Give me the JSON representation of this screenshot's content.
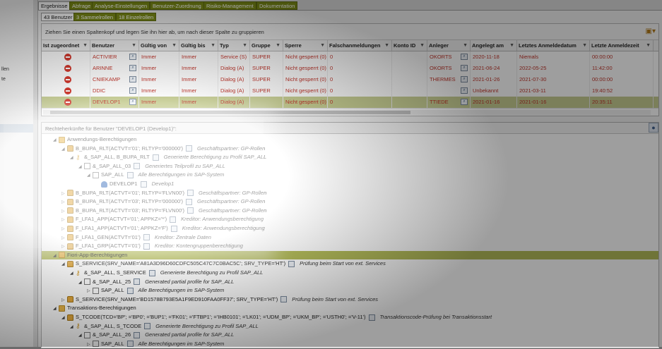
{
  "left_sidebar": {
    "labels": [
      "llen",
      "te"
    ]
  },
  "tabs": [
    {
      "label": "Ergebnisse",
      "active": true
    },
    {
      "label": "Abfrage",
      "active": false
    },
    {
      "label": "Analyse-Einstellungen",
      "active": false
    },
    {
      "label": "Benutzer-Zuordnung",
      "active": false
    },
    {
      "label": "Risiko-Management",
      "active": false
    },
    {
      "label": "Dokumentation",
      "active": false
    }
  ],
  "subtabs": [
    {
      "label": "43 Benutzer",
      "active": true
    },
    {
      "label": "3 Sammelrollen",
      "active": false
    },
    {
      "label": "18 Einzelrollen",
      "active": false
    }
  ],
  "grid": {
    "group_hint": "Ziehen Sie einen Spaltenkopf und legen Sie ihn hier ab, um nach dieser Spalte zu gruppieren",
    "columns": [
      "Ist zugeordnet",
      "Benutzer",
      "Gültig von",
      "Gültig bis",
      "Typ",
      "Gruppe",
      "Sperre",
      "Falschanmeldungen",
      "Konto ID",
      "Anleger",
      "Angelegt am",
      "Letztes Anmeldedatum",
      "Letzte Anmeldezeit"
    ],
    "rows": [
      {
        "user": "ACTIVIER",
        "from": "Immer",
        "to": "Immer",
        "type": "Service (S)",
        "group": "SUPER",
        "lock": "Nicht gesperrt (0)",
        "fails": "0",
        "account": "",
        "creator": "OKORTS",
        "created": "2020-11-18",
        "last_date": "Niemals",
        "last_time": "00:00:00"
      },
      {
        "user": "ARINNE",
        "from": "Immer",
        "to": "Immer",
        "type": "Dialog (A)",
        "group": "SUPER",
        "lock": "Nicht gesperrt (0)",
        "fails": "0",
        "account": "",
        "creator": "OKORTS",
        "created": "2021-06-24",
        "last_date": "2022-05-25",
        "last_time": "11:42:00"
      },
      {
        "user": "CNIEKAMP",
        "from": "Immer",
        "to": "Immer",
        "type": "Dialog (A)",
        "group": "SUPER",
        "lock": "Nicht gesperrt (0)",
        "fails": "0",
        "account": "",
        "creator": "THERMES",
        "created": "2021-01-26",
        "last_date": "2021-07-30",
        "last_time": "00:00:00"
      },
      {
        "user": "DDIC",
        "from": "Immer",
        "to": "Immer",
        "type": "Dialog (A)",
        "group": "SUPER",
        "lock": "Nicht gesperrt (0)",
        "fails": "0",
        "account": "",
        "creator": "",
        "created": "Unbekannt",
        "last_date": "2021-03-11",
        "last_time": "19:40:52"
      },
      {
        "user": "DEVELOP1",
        "from": "Immer",
        "to": "Immer",
        "type": "Dialog (A)",
        "group": "",
        "lock": "Nicht gesperrt (0)",
        "fails": "0",
        "account": "",
        "creator": "TTIEDE",
        "created": "2021-01-16",
        "last_date": "2021-01-16",
        "last_time": "20:35:11"
      }
    ]
  },
  "details": {
    "title": "Rechteherkünfte für Benutzer \"DEVELOP1 (Develop1)\":",
    "tree": [
      {
        "label": "Anwendungs-Berechtigungen",
        "desc": "",
        "icon": "folder-icon",
        "toggle": "◢"
      },
      {
        "label": "B_BUPA_RLT(ACTVT='01'; RLTYP='000000')",
        "desc": "Geschäftspartner: GP-Rollen",
        "icon": "lock-icon",
        "toggle": "◢"
      },
      {
        "label": "&_SAP_ALL, B_BUPA_RLT",
        "desc": "Generierte Berechtigung zu Profil SAP_ALL",
        "icon": "key-icon",
        "toggle": "◢"
      },
      {
        "label": "&_SAP_ALL_03",
        "desc": "Generiertes Teilprofil zu SAP_ALL",
        "icon": "profile-icon",
        "toggle": "◢"
      },
      {
        "label": "SAP_ALL",
        "desc": "Alle Berechtigungen im SAP-System",
        "icon": "profile-icon",
        "toggle": "◢"
      },
      {
        "label": "DEVELOP1",
        "desc": "Develop1",
        "icon": "user-icon",
        "toggle": ""
      },
      {
        "label": "B_BUPA_RLT(ACTVT='01'; RLTYP='FLVN00')",
        "desc": "Geschäftspartner: GP-Rollen",
        "icon": "lock-icon",
        "toggle": "▷"
      },
      {
        "label": "B_BUPA_RLT(ACTVT='03'; RLTYP='000000')",
        "desc": "Geschäftspartner: GP-Rollen",
        "icon": "lock-icon",
        "toggle": "▷"
      },
      {
        "label": "B_BUPA_RLT(ACTVT='03'; RLTYP='FLVN00')",
        "desc": "Geschäftspartner: GP-Rollen",
        "icon": "lock-icon",
        "toggle": "▷"
      },
      {
        "label": "F_LFA1_APP(ACTVT='01'; APPKZ='*')",
        "desc": "Kreditor: Anwendungsberechtigung",
        "icon": "lock-icon",
        "toggle": "▷"
      },
      {
        "label": "F_LFA1_APP(ACTVT='01'; APPKZ='F')",
        "desc": "Kreditor: Anwendungsberechtigung",
        "icon": "lock-icon",
        "toggle": "▷"
      },
      {
        "label": "F_LFA1_GEN(ACTVT='01')",
        "desc": "Kreditor: Zentrale Daten",
        "icon": "lock-icon",
        "toggle": "▷"
      },
      {
        "label": "F_LFA1_GRP(ACTVT='01')",
        "desc": "Kreditor: Kontengruppenberechtigung",
        "icon": "lock-icon",
        "toggle": "▷"
      },
      {
        "label": "Fiori-App-Berechtigungen",
        "desc": "",
        "icon": "folder-icon",
        "toggle": "◢"
      },
      {
        "label": "S_SERVICE(SRV_NAME='A81A3D96D60CDFC505C47C7C0BAC5C'; SRV_TYPE='HT')",
        "desc": "Prüfung beim Start von ext. Services",
        "icon": "lock-icon",
        "toggle": "◢"
      },
      {
        "label": "&_SAP_ALL, S_SERVICE",
        "desc": "Generierte Berechtigung zu Profil SAP_ALL",
        "icon": "key-icon",
        "toggle": "◢"
      },
      {
        "label": "&_SAP_ALL_25",
        "desc": "Generated partial profile for SAP_ALL",
        "icon": "profile-icon",
        "toggle": "◢"
      },
      {
        "label": "SAP_ALL",
        "desc": "Alle Berechtigungen im SAP-System",
        "icon": "profile-icon",
        "toggle": "▷"
      },
      {
        "label": "S_SERVICE(SRV_NAME='BD1578B793E5A1F9ED910FAA0FF37'; SRV_TYPE='HT')",
        "desc": "Prüfung beim Start von ext. Services",
        "icon": "lock-icon",
        "toggle": "▷"
      },
      {
        "label": "Transaktions-Berechtigungen",
        "desc": "",
        "icon": "folder-icon",
        "toggle": "◢"
      },
      {
        "label": "S_TCODE(TCD='BP'; ='BP0'; ='BUP1'; ='FK01'; ='FTBP1'; ='IHB0101'; ='LK01'; ='UDM_BP'; ='UKM_BP'; ='USTH0'; ='V-11')",
        "desc": "Transaktionscode-Prüfung bei Transaktionsstart",
        "icon": "lock-icon",
        "toggle": "◢"
      },
      {
        "label": "&_SAP_ALL, S_TCODE",
        "desc": "Generierte Berechtigung zu Profil SAP_ALL",
        "icon": "key-icon",
        "toggle": "◢"
      },
      {
        "label": "&_SAP_ALL_26",
        "desc": "Generated partial profile for SAP_ALL",
        "icon": "profile-icon",
        "toggle": "◢"
      },
      {
        "label": "SAP_ALL",
        "desc": "Alle Berechtigungen im SAP-System",
        "icon": "profile-icon",
        "toggle": "▷"
      }
    ]
  }
}
